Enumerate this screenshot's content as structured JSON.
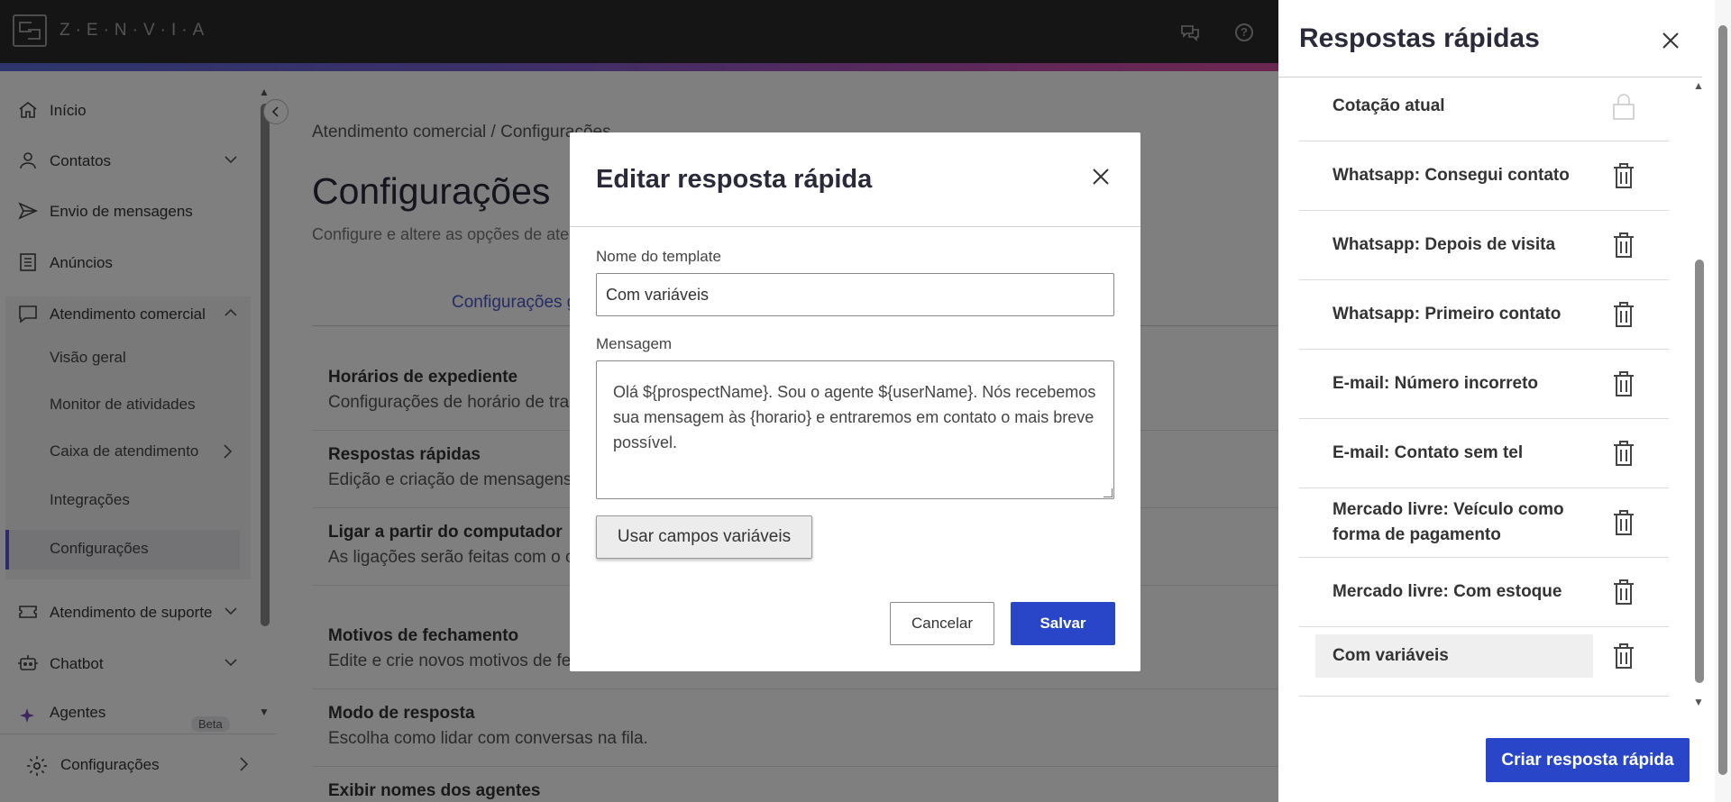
{
  "topbar": {
    "logo_text": "Z·E·N·V·I·A",
    "icons": [
      "chat-icon",
      "help-icon"
    ],
    "help_glyph": "?"
  },
  "sidebar": {
    "items": [
      {
        "label": "Início",
        "icon": "home-icon"
      },
      {
        "label": "Contatos",
        "icon": "user-icon"
      },
      {
        "label": "Envio de mensagens",
        "icon": "send-icon"
      },
      {
        "label": "Anúncios",
        "icon": "list-icon"
      },
      {
        "label": "Atendimento comercial",
        "icon": "chat-bubble-icon"
      }
    ],
    "subitems": [
      "Visão geral",
      "Monitor de atividades",
      "Caixa de atendimento",
      "Integrações",
      "Configurações"
    ],
    "items_bottom": [
      {
        "label": "Atendimento de suporte",
        "icon": "ticket-icon"
      },
      {
        "label": "Chatbot",
        "icon": "robot-icon"
      },
      {
        "label": "Agentes",
        "icon": "sparkle-icon"
      }
    ],
    "beta_badge": "Beta",
    "footer_label": "Configurações"
  },
  "main": {
    "breadcrumb": "Atendimento comercial  /  Configurações",
    "title": "Configurações",
    "subtitle": "Configure e altere as opções de atendimento",
    "tab": "Configurações gerais",
    "settings": [
      {
        "title": "Horários de expediente",
        "desc": "Configurações de horário de trabalho"
      },
      {
        "title": "Respostas rápidas",
        "desc": "Edição e criação de mensagens"
      },
      {
        "title": "Ligar a partir do computador",
        "desc": "As ligações serão feitas com o computador ao invés do celular."
      },
      {
        "title": "Motivos de fechamento",
        "desc": "Edite e crie novos motivos de fechamento"
      },
      {
        "title": "Modo de resposta",
        "desc": "Escolha como lidar com conversas na fila."
      },
      {
        "title": "Exibir nomes dos agentes",
        "desc": ""
      }
    ]
  },
  "modal": {
    "title": "Editar resposta rápida",
    "template_label": "Nome do template",
    "template_value": "Com variáveis",
    "message_label": "Mensagem",
    "message_value": "Olá ${prospectName}. Sou o agente ${userName}. Nós recebemos sua mensagem às {horario} e entraremos em contato o mais breve possível.",
    "vars_button": "Usar campos variáveis",
    "cancel_button": "Cancelar",
    "save_button": "Salvar"
  },
  "panel": {
    "title": "Respostas rápidas",
    "items": [
      {
        "label": "Cotação atual",
        "icon": "lock-icon"
      },
      {
        "label": "Whatsapp: Consegui contato",
        "icon": "trash-icon"
      },
      {
        "label": "Whatsapp: Depois de visita",
        "icon": "trash-icon"
      },
      {
        "label": "Whatsapp: Primeiro contato",
        "icon": "trash-icon"
      },
      {
        "label": "E-mail: Número incorreto",
        "icon": "trash-icon"
      },
      {
        "label": "E-mail: Contato sem tel",
        "icon": "trash-icon"
      },
      {
        "label": "Mercado livre: Veículo como forma de pagamento",
        "icon": "trash-icon"
      },
      {
        "label": "Mercado livre: Com estoque",
        "icon": "trash-icon"
      },
      {
        "label": "Com variáveis",
        "icon": "trash-icon",
        "selected": true
      }
    ],
    "create_button": "Criar resposta rápida"
  },
  "colors": {
    "primary": "#2a46c8",
    "active_nav": "#5b53d6",
    "topbar": "#2b2b2b"
  }
}
